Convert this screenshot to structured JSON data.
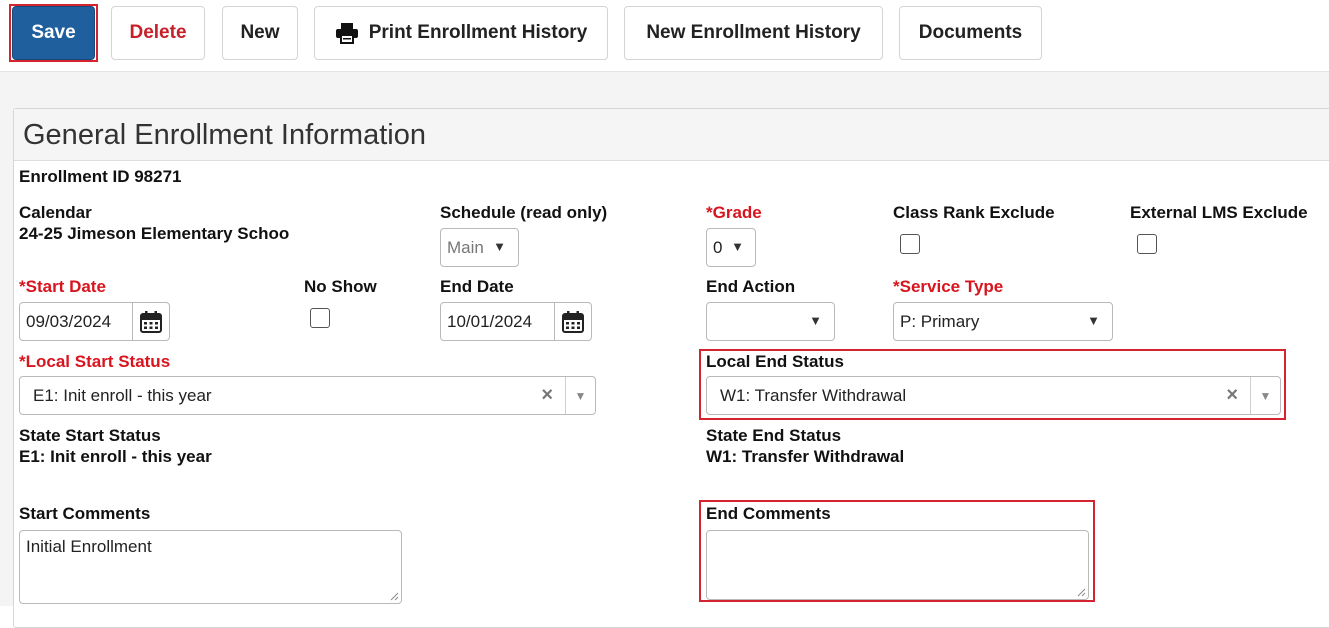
{
  "toolbar": {
    "save_label": "Save",
    "delete_label": "Delete",
    "new_label": "New",
    "print_label": "Print Enrollment History",
    "new_history_label": "New Enrollment History",
    "documents_label": "Documents"
  },
  "panel": {
    "title": "General Enrollment Information"
  },
  "enrollment_id": "Enrollment ID 98271",
  "calendar": {
    "label": "Calendar",
    "value": "24-25 Jimeson Elementary Schoo"
  },
  "schedule": {
    "label": "Schedule (read only)",
    "value": "Main"
  },
  "grade": {
    "label": "*Grade",
    "value": "0"
  },
  "class_rank_exclude": {
    "label": "Class Rank Exclude",
    "checked": false
  },
  "external_lms_exclude": {
    "label": "External LMS Exclude",
    "checked": false
  },
  "start_date": {
    "label": "*Start Date",
    "value": "09/03/2024"
  },
  "no_show": {
    "label": "No Show",
    "checked": false
  },
  "end_date": {
    "label": "End Date",
    "value": "10/01/2024"
  },
  "end_action": {
    "label": "End Action",
    "value": ""
  },
  "service_type": {
    "label": "*Service Type",
    "value": "P: Primary"
  },
  "local_start_status": {
    "label": "*Local Start Status",
    "value": "E1: Init enroll - this year"
  },
  "local_end_status": {
    "label": "Local End Status",
    "value": "W1: Transfer Withdrawal"
  },
  "state_start_status": {
    "label": "State Start Status",
    "value": "E1: Init enroll - this year"
  },
  "state_end_status": {
    "label": "State End Status",
    "value": "W1: Transfer Withdrawal"
  },
  "start_comments": {
    "label": "Start Comments",
    "value": "Initial Enrollment"
  },
  "end_comments": {
    "label": "End Comments",
    "value": ""
  },
  "icons": {
    "printer": "printer-icon",
    "calendar": "calendar-icon",
    "dropdown": "chevron-down-icon",
    "clear": "clear-x-icon"
  },
  "colors": {
    "save_bg": "#1f5f9e",
    "required_red": "#d8151f",
    "highlight_red": "#d3242f"
  }
}
